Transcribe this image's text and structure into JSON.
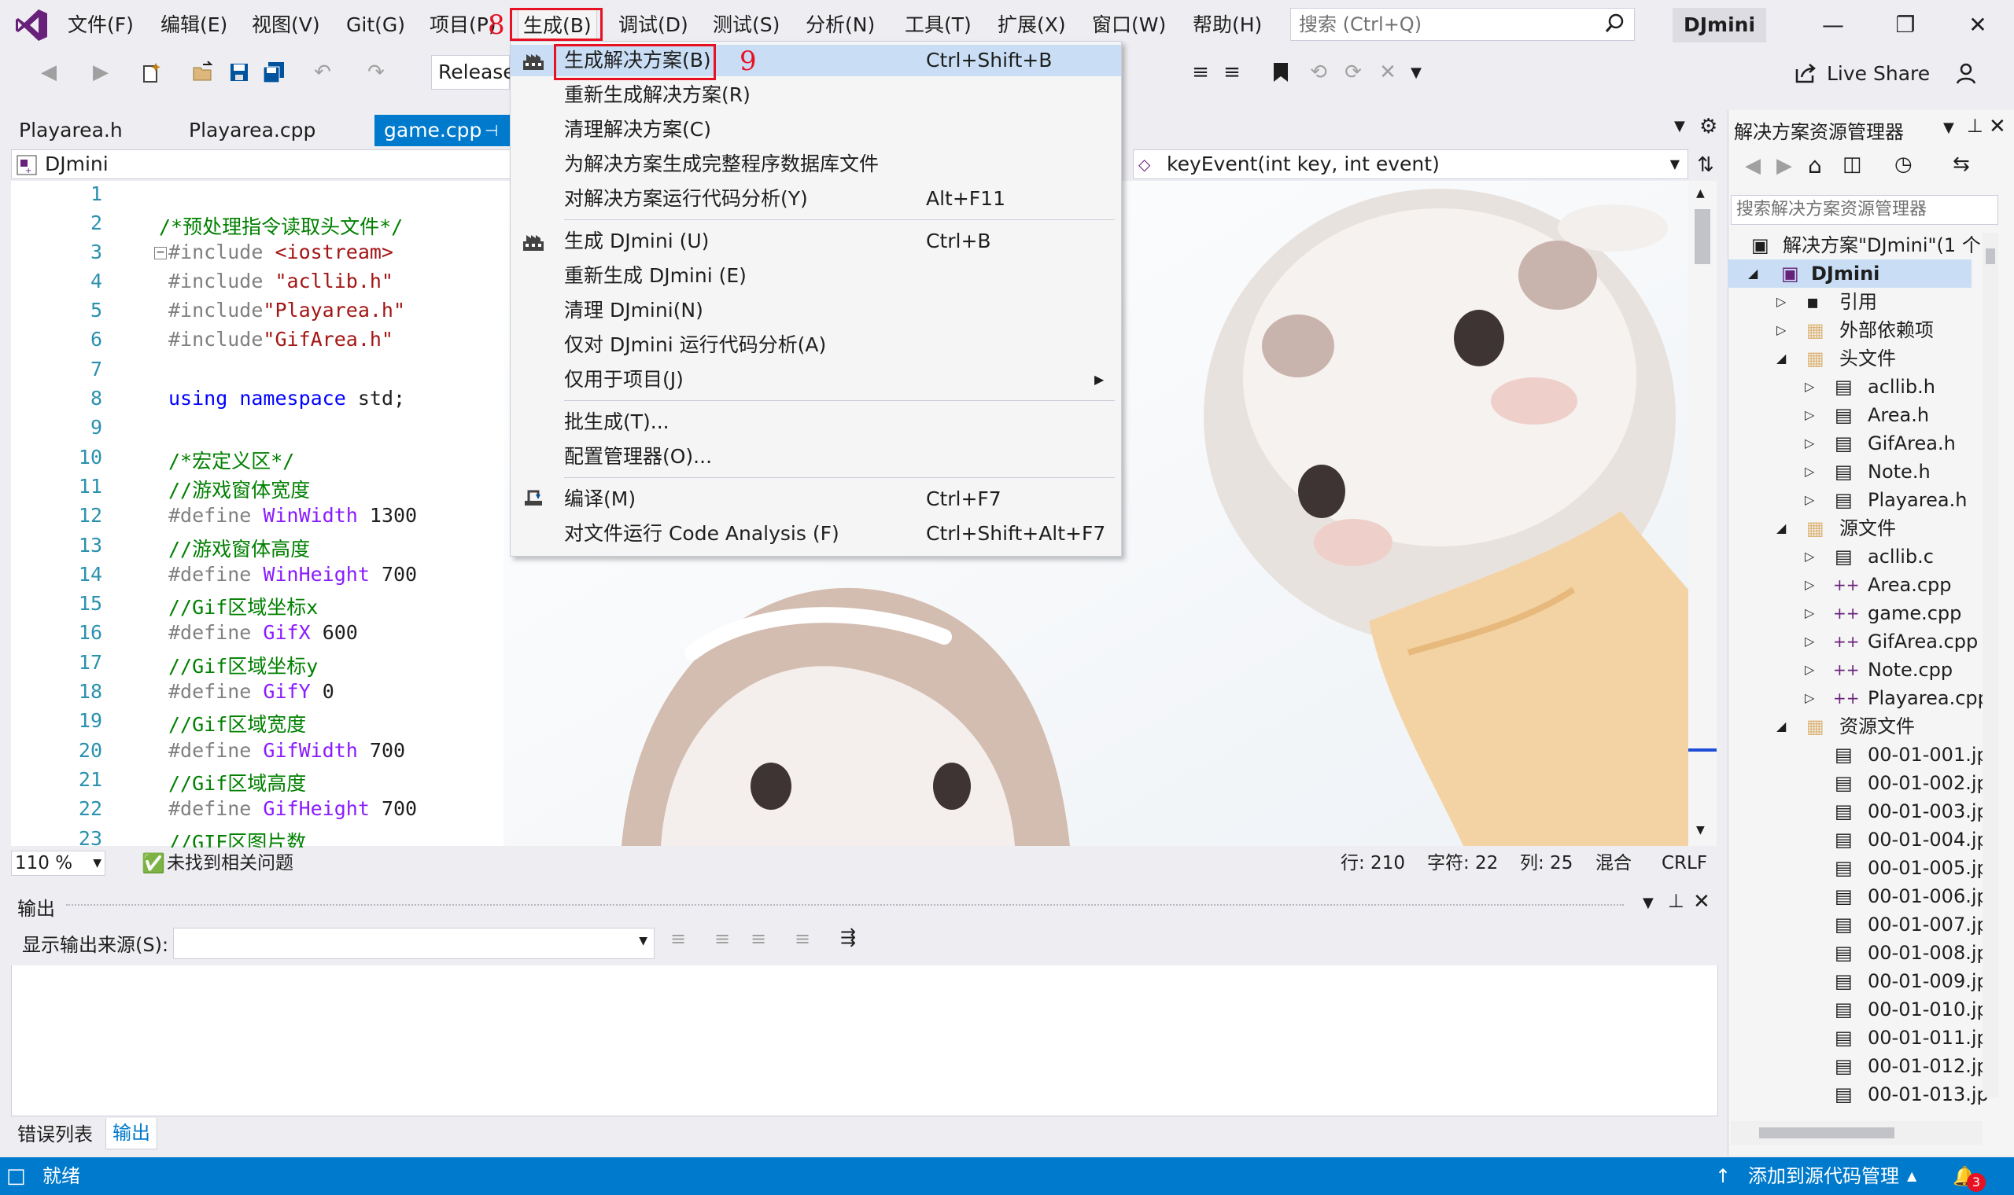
{
  "menubar": {
    "items": [
      "文件(F)",
      "编辑(E)",
      "视图(V)",
      "Git(G)",
      "项目(P)",
      "生成(B)",
      "调试(D)",
      "测试(S)",
      "分析(N)",
      "工具(T)",
      "扩展(X)",
      "窗口(W)",
      "帮助(H)"
    ],
    "search_placeholder": "搜索 (Ctrl+Q)",
    "project_name": "DJmini"
  },
  "toolbar": {
    "config": "Release",
    "live_share": "Live Share"
  },
  "doc_tabs": [
    "Playarea.h",
    "Playarea.cpp",
    "game.cpp"
  ],
  "editor": {
    "scope": "DJmini",
    "member": "keyEvent(int key, int event)",
    "zoom": "110 %",
    "issues": "未找到相关问题",
    "position": {
      "line": "行: 210",
      "char": "字符: 22",
      "col": "列: 25",
      "mode": "混合",
      "eol": "CRLF"
    },
    "line_numbers": [
      "1",
      "2",
      "3",
      "4",
      "5",
      "6",
      "7",
      "8",
      "9",
      "10",
      "11",
      "12",
      "13",
      "14",
      "15",
      "16",
      "17",
      "18",
      "19",
      "20",
      "21",
      "22",
      "23"
    ],
    "lines": {
      "l2": "/*预处理指令读取头文件*/",
      "l3a": "#include ",
      "l3b": "<iostream>",
      "l4a": "#include ",
      "l4b": "\"acllib.h\"",
      "l5a": "#include",
      "l5b": "\"Playarea.h\"",
      "l6a": "#include",
      "l6b": "\"GifArea.h\"",
      "l8a": "using",
      "l8b": "namespace",
      "l8c": " std;",
      "l10": "/*宏定义区*/",
      "l11": "//游戏窗体宽度",
      "l12a": "#define ",
      "l12b": "WinWidth",
      "l12c": " 1300",
      "l13": "//游戏窗体高度",
      "l14a": "#define ",
      "l14b": "WinHeight",
      "l14c": " 700",
      "l15": "//Gif区域坐标x",
      "l16a": "#define ",
      "l16b": "GifX",
      "l16c": " 600",
      "l17": "//Gif区域坐标y",
      "l18a": "#define ",
      "l18b": "GifY",
      "l18c": " 0",
      "l19": "//Gif区域宽度",
      "l20a": "#define ",
      "l20b": "GifWidth",
      "l20c": " 700",
      "l21": "//Gif区域高度",
      "l22a": "#define ",
      "l22b": "GifHeight",
      "l22c": " 700",
      "l23": "//GIF区图片数"
    }
  },
  "build_menu": {
    "items": [
      {
        "label": "生成解决方案(B)",
        "shortcut": "Ctrl+Shift+B"
      },
      {
        "label": "重新生成解决方案(R)",
        "shortcut": ""
      },
      {
        "label": "清理解决方案(C)",
        "shortcut": ""
      },
      {
        "label": "为解决方案生成完整程序数据库文件",
        "shortcut": ""
      },
      {
        "label": "对解决方案运行代码分析(Y)",
        "shortcut": "Alt+F11"
      },
      {
        "label": "生成 DJmini (U)",
        "shortcut": "Ctrl+B"
      },
      {
        "label": "重新生成 DJmini (E)",
        "shortcut": ""
      },
      {
        "label": "清理 DJmini(N)",
        "shortcut": ""
      },
      {
        "label": "仅对 DJmini 运行代码分析(A)",
        "shortcut": ""
      },
      {
        "label": "仅用于项目(J)",
        "shortcut": ""
      },
      {
        "label": "批生成(T)...",
        "shortcut": ""
      },
      {
        "label": "配置管理器(O)...",
        "shortcut": ""
      },
      {
        "label": "编译(M)",
        "shortcut": "Ctrl+F7"
      },
      {
        "label": "对文件运行 Code Analysis (F)",
        "shortcut": "Ctrl+Shift+Alt+F7"
      }
    ]
  },
  "annotations": {
    "step8": "8",
    "step9": "9"
  },
  "output_panel": {
    "title": "输出",
    "source_label": "显示输出来源(S):"
  },
  "bottom_tabs": [
    "错误列表",
    "输出"
  ],
  "solution_explorer": {
    "title": "解决方案资源管理器",
    "search_placeholder": "搜索解决方案资源管理器",
    "solution": "解决方案\"DJmini\"(1 个",
    "project": "DJmini",
    "nodes": [
      "引用",
      "外部依赖项",
      "头文件",
      "acllib.h",
      "Area.h",
      "GifArea.h",
      "Note.h",
      "Playarea.h",
      "源文件",
      "acllib.c",
      "Area.cpp",
      "game.cpp",
      "GifArea.cpp",
      "Note.cpp",
      "Playarea.cpp",
      "资源文件",
      "00-01-001.jp",
      "00-01-002.jp",
      "00-01-003.jp",
      "00-01-004.jp",
      "00-01-005.jp",
      "00-01-006.jp",
      "00-01-007.jp",
      "00-01-008.jp",
      "00-01-009.jp",
      "00-01-010.jp",
      "00-01-011.jp",
      "00-01-012.jp",
      "00-01-013.jp"
    ]
  },
  "statusbar": {
    "ready": "就绪",
    "source_control": "添加到源代码管理",
    "notifications": "3"
  },
  "colors": {
    "accent": "#007acc",
    "highlight": "#c9def5",
    "annotation": "#e81123"
  }
}
